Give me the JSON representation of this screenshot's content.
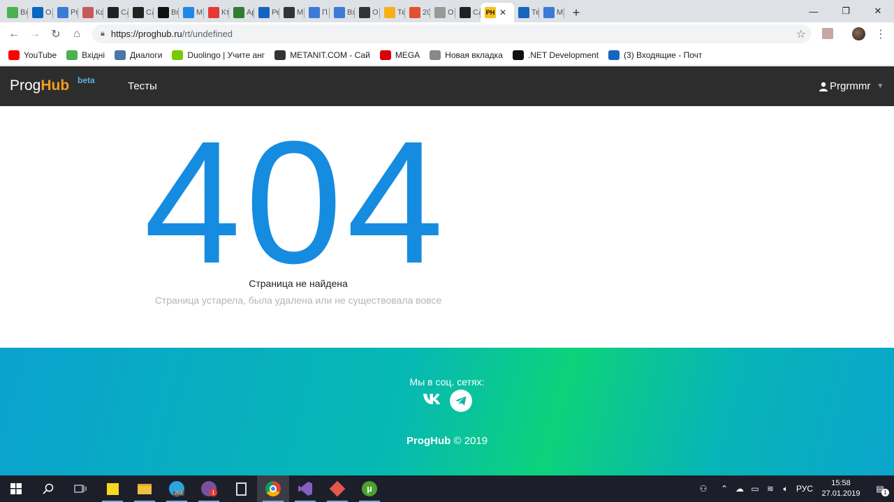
{
  "browser": {
    "tabs": [
      {
        "label": "Вх",
        "icon": "mail-icon",
        "color": "#4caf50"
      },
      {
        "label": "О.",
        "icon": "linkedin-icon",
        "color": "#0a66c2"
      },
      {
        "label": "Pr",
        "icon": "share-nodes-icon",
        "color": "#3b7bd6"
      },
      {
        "label": "Ка",
        "icon": "image-icon",
        "color": "#c45a5a"
      },
      {
        "label": "Сл",
        "icon": "hd-icon",
        "color": "#222222"
      },
      {
        "label": "Сл",
        "icon": "hd-icon",
        "color": "#222222"
      },
      {
        "label": "Вг",
        "icon": "github-icon",
        "color": "#111111"
      },
      {
        "label": "М",
        "icon": "target-icon",
        "color": "#1e88e5"
      },
      {
        "label": "Кт",
        "icon": "circle-r-icon",
        "color": "#e53935"
      },
      {
        "label": "Ар",
        "icon": "letter-a-icon",
        "color": "#2e7d32"
      },
      {
        "label": "Ре",
        "icon": "q-icon",
        "color": "#1565c0"
      },
      {
        "label": "М",
        "icon": "metanit-icon",
        "color": "#333333"
      },
      {
        "label": "П",
        "icon": "share-nodes-icon",
        "color": "#3b7bd6"
      },
      {
        "label": "Вх",
        "icon": "share-nodes-icon",
        "color": "#3b7bd6"
      },
      {
        "label": "О",
        "icon": "metanit-icon",
        "color": "#333333"
      },
      {
        "label": "Те",
        "icon": "puzzle-icon",
        "color": "#f6b01c"
      },
      {
        "label": "20",
        "icon": "calendar-icon",
        "color": "#e2512f"
      },
      {
        "label": "О",
        "icon": "blank-icon",
        "color": "#999999"
      },
      {
        "label": "Сл",
        "icon": "hd-icon",
        "color": "#222222"
      }
    ],
    "active_tab": {
      "icon_text": "PH",
      "icon": "proghub-icon"
    },
    "tabs_after": [
      {
        "label": "Те",
        "icon": "q-icon",
        "color": "#1565c0"
      },
      {
        "label": "М",
        "icon": "share-nodes-icon",
        "color": "#3b7bd6"
      }
    ],
    "new_tab": "+",
    "url_host": "https://proghub.ru",
    "url_path": "/rt/undefined",
    "bookmarks": [
      {
        "label": "YouTube",
        "icon": "youtube-icon",
        "color": "#ff0000"
      },
      {
        "label": "Вхідні",
        "icon": "mail-icon",
        "color": "#4caf50"
      },
      {
        "label": "Диалоги",
        "icon": "chat-icon",
        "color": "#4a76a8"
      },
      {
        "label": "Duolingo | Учите анг",
        "icon": "duolingo-icon",
        "color": "#78c800"
      },
      {
        "label": "METANIT.COM - Сай",
        "icon": "metanit-icon",
        "color": "#333333"
      },
      {
        "label": "MEGA",
        "icon": "mega-icon",
        "color": "#d90007"
      },
      {
        "label": "Новая вкладка",
        "icon": "page-icon",
        "color": "#888888"
      },
      {
        "label": ".NET Development",
        "icon": "letter-s-icon",
        "color": "#111111"
      },
      {
        "label": "(3) Входящие - Почт",
        "icon": "at-mail-icon",
        "color": "#1565c0"
      }
    ]
  },
  "site": {
    "brand_prog": "Prog",
    "brand_hub": "Hub",
    "brand_beta": "beta",
    "nav_tests": "Тесты",
    "username": "Prgrmmr"
  },
  "error": {
    "code": "404",
    "title": "Страница не найдена",
    "subtitle": "Страница устарела, была удалена или не существовала вовсе"
  },
  "footer": {
    "social_title": "Мы в соц. сетях:",
    "vk_label": "VK",
    "brand": "ProgHub",
    "copyright": "© 2019"
  },
  "taskbar": {
    "telegram_badge": "203",
    "viber_badge": "1",
    "lang": "РУС",
    "time": "15:58",
    "date": "27.01.2019",
    "notif_count": "1"
  },
  "colors": {
    "accent_blue": "#158ce0",
    "brand_orange": "#f49d1c",
    "nav_bg": "#2d2d2d"
  }
}
